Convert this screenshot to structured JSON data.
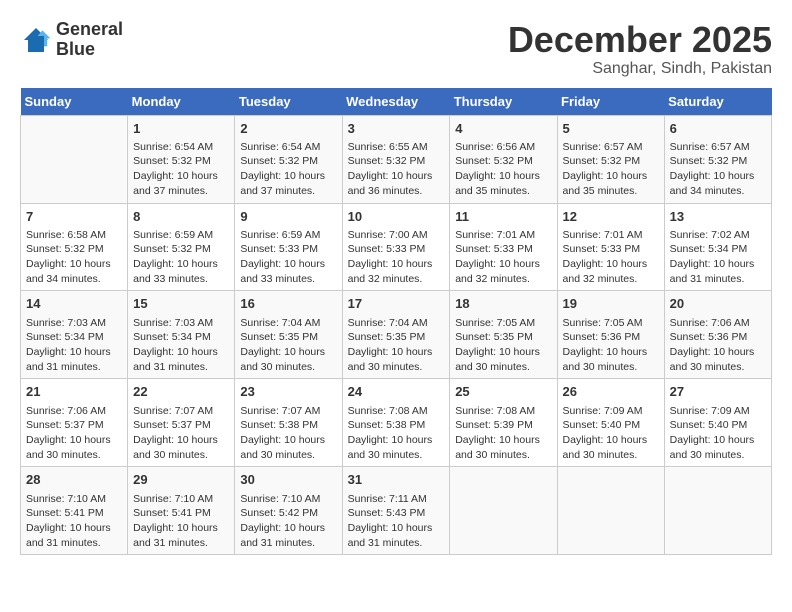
{
  "logo": {
    "line1": "General",
    "line2": "Blue"
  },
  "title": "December 2025",
  "subtitle": "Sanghar, Sindh, Pakistan",
  "header": {
    "days": [
      "Sunday",
      "Monday",
      "Tuesday",
      "Wednesday",
      "Thursday",
      "Friday",
      "Saturday"
    ]
  },
  "weeks": [
    [
      {
        "day": "",
        "data": ""
      },
      {
        "day": "1",
        "data": "Sunrise: 6:54 AM\nSunset: 5:32 PM\nDaylight: 10 hours\nand 37 minutes."
      },
      {
        "day": "2",
        "data": "Sunrise: 6:54 AM\nSunset: 5:32 PM\nDaylight: 10 hours\nand 37 minutes."
      },
      {
        "day": "3",
        "data": "Sunrise: 6:55 AM\nSunset: 5:32 PM\nDaylight: 10 hours\nand 36 minutes."
      },
      {
        "day": "4",
        "data": "Sunrise: 6:56 AM\nSunset: 5:32 PM\nDaylight: 10 hours\nand 35 minutes."
      },
      {
        "day": "5",
        "data": "Sunrise: 6:57 AM\nSunset: 5:32 PM\nDaylight: 10 hours\nand 35 minutes."
      },
      {
        "day": "6",
        "data": "Sunrise: 6:57 AM\nSunset: 5:32 PM\nDaylight: 10 hours\nand 34 minutes."
      }
    ],
    [
      {
        "day": "7",
        "data": "Sunrise: 6:58 AM\nSunset: 5:32 PM\nDaylight: 10 hours\nand 34 minutes."
      },
      {
        "day": "8",
        "data": "Sunrise: 6:59 AM\nSunset: 5:32 PM\nDaylight: 10 hours\nand 33 minutes."
      },
      {
        "day": "9",
        "data": "Sunrise: 6:59 AM\nSunset: 5:33 PM\nDaylight: 10 hours\nand 33 minutes."
      },
      {
        "day": "10",
        "data": "Sunrise: 7:00 AM\nSunset: 5:33 PM\nDaylight: 10 hours\nand 32 minutes."
      },
      {
        "day": "11",
        "data": "Sunrise: 7:01 AM\nSunset: 5:33 PM\nDaylight: 10 hours\nand 32 minutes."
      },
      {
        "day": "12",
        "data": "Sunrise: 7:01 AM\nSunset: 5:33 PM\nDaylight: 10 hours\nand 32 minutes."
      },
      {
        "day": "13",
        "data": "Sunrise: 7:02 AM\nSunset: 5:34 PM\nDaylight: 10 hours\nand 31 minutes."
      }
    ],
    [
      {
        "day": "14",
        "data": "Sunrise: 7:03 AM\nSunset: 5:34 PM\nDaylight: 10 hours\nand 31 minutes."
      },
      {
        "day": "15",
        "data": "Sunrise: 7:03 AM\nSunset: 5:34 PM\nDaylight: 10 hours\nand 31 minutes."
      },
      {
        "day": "16",
        "data": "Sunrise: 7:04 AM\nSunset: 5:35 PM\nDaylight: 10 hours\nand 30 minutes."
      },
      {
        "day": "17",
        "data": "Sunrise: 7:04 AM\nSunset: 5:35 PM\nDaylight: 10 hours\nand 30 minutes."
      },
      {
        "day": "18",
        "data": "Sunrise: 7:05 AM\nSunset: 5:35 PM\nDaylight: 10 hours\nand 30 minutes."
      },
      {
        "day": "19",
        "data": "Sunrise: 7:05 AM\nSunset: 5:36 PM\nDaylight: 10 hours\nand 30 minutes."
      },
      {
        "day": "20",
        "data": "Sunrise: 7:06 AM\nSunset: 5:36 PM\nDaylight: 10 hours\nand 30 minutes."
      }
    ],
    [
      {
        "day": "21",
        "data": "Sunrise: 7:06 AM\nSunset: 5:37 PM\nDaylight: 10 hours\nand 30 minutes."
      },
      {
        "day": "22",
        "data": "Sunrise: 7:07 AM\nSunset: 5:37 PM\nDaylight: 10 hours\nand 30 minutes."
      },
      {
        "day": "23",
        "data": "Sunrise: 7:07 AM\nSunset: 5:38 PM\nDaylight: 10 hours\nand 30 minutes."
      },
      {
        "day": "24",
        "data": "Sunrise: 7:08 AM\nSunset: 5:38 PM\nDaylight: 10 hours\nand 30 minutes."
      },
      {
        "day": "25",
        "data": "Sunrise: 7:08 AM\nSunset: 5:39 PM\nDaylight: 10 hours\nand 30 minutes."
      },
      {
        "day": "26",
        "data": "Sunrise: 7:09 AM\nSunset: 5:40 PM\nDaylight: 10 hours\nand 30 minutes."
      },
      {
        "day": "27",
        "data": "Sunrise: 7:09 AM\nSunset: 5:40 PM\nDaylight: 10 hours\nand 30 minutes."
      }
    ],
    [
      {
        "day": "28",
        "data": "Sunrise: 7:10 AM\nSunset: 5:41 PM\nDaylight: 10 hours\nand 31 minutes."
      },
      {
        "day": "29",
        "data": "Sunrise: 7:10 AM\nSunset: 5:41 PM\nDaylight: 10 hours\nand 31 minutes."
      },
      {
        "day": "30",
        "data": "Sunrise: 7:10 AM\nSunset: 5:42 PM\nDaylight: 10 hours\nand 31 minutes."
      },
      {
        "day": "31",
        "data": "Sunrise: 7:11 AM\nSunset: 5:43 PM\nDaylight: 10 hours\nand 31 minutes."
      },
      {
        "day": "",
        "data": ""
      },
      {
        "day": "",
        "data": ""
      },
      {
        "day": "",
        "data": ""
      }
    ]
  ]
}
